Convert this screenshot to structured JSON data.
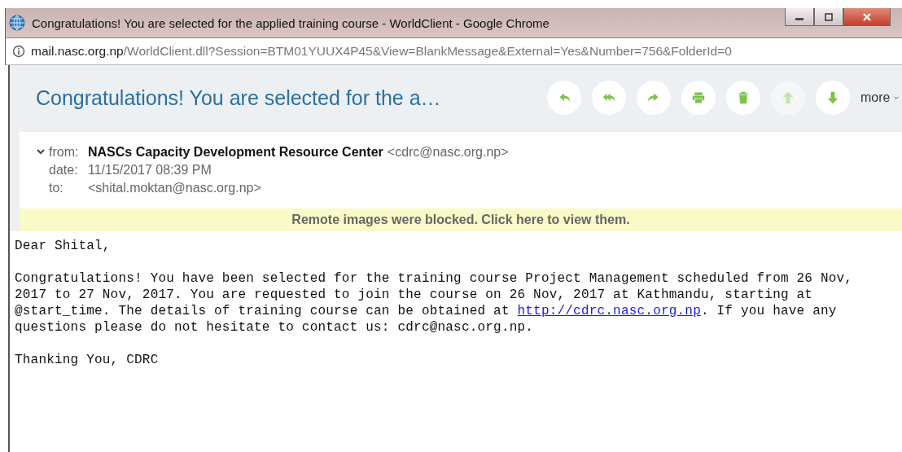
{
  "window": {
    "title": "Congratulations! You are selected for the applied training course - WorldClient - Google Chrome"
  },
  "address_bar": {
    "host": "mail.nasc.org.np",
    "path": "/WorldClient.dll?Session=BTM01YUUX4P45&View=BlankMessage&External=Yes&Number=756&FolderId=0"
  },
  "message": {
    "subject": "Congratulations! You are selected for the a…",
    "toolbar": [
      {
        "kind": "reply",
        "disabled": false
      },
      {
        "kind": "reply-all",
        "disabled": false
      },
      {
        "kind": "forward",
        "disabled": false
      },
      {
        "kind": "print",
        "disabled": false
      },
      {
        "kind": "delete",
        "disabled": false
      },
      {
        "kind": "up",
        "disabled": true
      },
      {
        "kind": "down",
        "disabled": false
      }
    ],
    "more": "more",
    "headers_expanded": true,
    "headers": [
      {
        "label": "from:",
        "name": "NASCs Capacity Development Resource Center",
        "value": "<cdrc@nasc.org.np>"
      },
      {
        "label": "date:",
        "value": "11/15/2017 08:39 PM"
      },
      {
        "label": "to:",
        "value": "<shital.moktan@nasc.org.np>"
      }
    ],
    "banner": "Remote images were blocked. Click here to view them.",
    "body": [
      {
        "text": "Dear Shital,"
      },
      {
        "before": "Congratulations! You have been selected for the training course Project Management scheduled from 26 Nov,\n2017 to 27 Nov, 2017. You are requested to join the course on 26 Nov, 2017 at Kathmandu, starting at\n@start_time. The details of training course can be obtained at ",
        "link": "http://cdrc.nasc.org.np",
        "after": ". If you have any\nquestions please do not hesitate to contact us: cdrc@nasc.org.np."
      },
      {
        "text": "Thanking You, CDRC"
      }
    ]
  }
}
